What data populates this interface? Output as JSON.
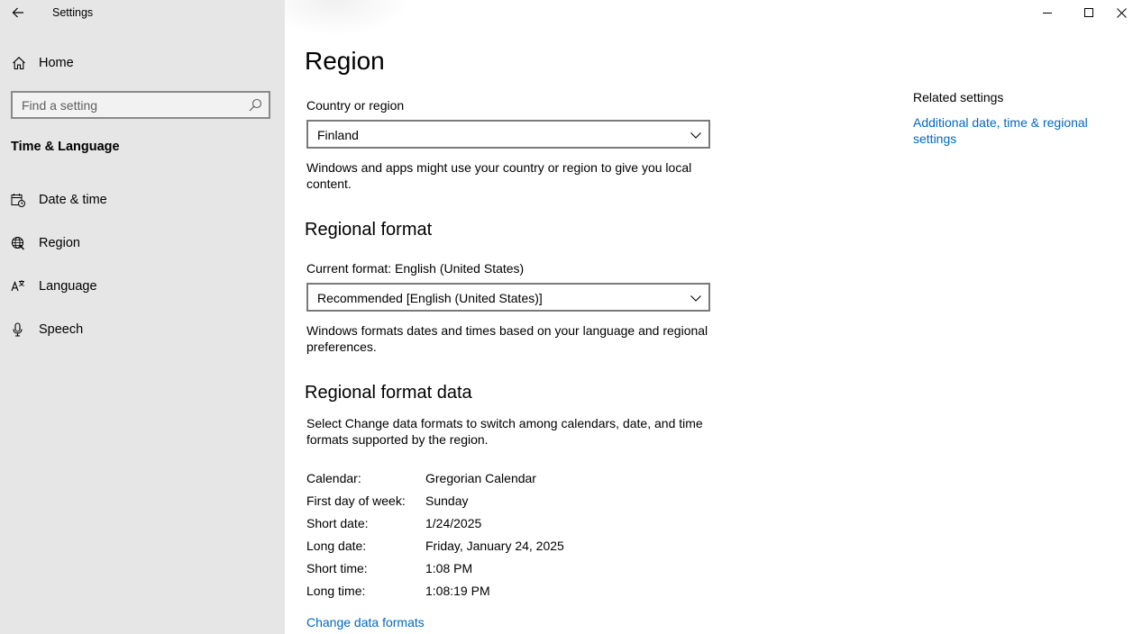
{
  "window": {
    "title": "Settings"
  },
  "sidebar": {
    "home_label": "Home",
    "search": {
      "placeholder": "Find a setting",
      "value": ""
    },
    "section_heading": "Time & Language",
    "items": [
      {
        "label": "Date & time",
        "icon": "calendar-clock-icon"
      },
      {
        "label": "Region",
        "icon": "globe-icon"
      },
      {
        "label": "Language",
        "icon": "language-icon"
      },
      {
        "label": "Speech",
        "icon": "microphone-icon"
      }
    ]
  },
  "main": {
    "title": "Region",
    "country": {
      "label": "Country or region",
      "selected": "Finland",
      "description": "Windows and apps might use your country or region to give you local content."
    },
    "regional_format": {
      "heading": "Regional format",
      "current_label": "Current format: English (United States)",
      "selected": "Recommended [English (United States)]",
      "description": "Windows formats dates and times based on your language and regional preferences."
    },
    "format_data": {
      "heading": "Regional format data",
      "description": "Select Change data formats to switch among calendars, date, and time formats supported by the region.",
      "rows": [
        {
          "key": "Calendar:",
          "value": "Gregorian Calendar"
        },
        {
          "key": "First day of week:",
          "value": "Sunday"
        },
        {
          "key": "Short date:",
          "value": "1/24/2025"
        },
        {
          "key": "Long date:",
          "value": "Friday, January 24, 2025"
        },
        {
          "key": "Short time:",
          "value": "1:08 PM"
        },
        {
          "key": "Long time:",
          "value": "1:08:19 PM"
        }
      ],
      "change_link": "Change data formats"
    }
  },
  "related": {
    "title": "Related settings",
    "link": "Additional date, time & regional settings"
  },
  "colors": {
    "sidebar_bg": "#e6e6e6",
    "link": "#0067c0"
  }
}
